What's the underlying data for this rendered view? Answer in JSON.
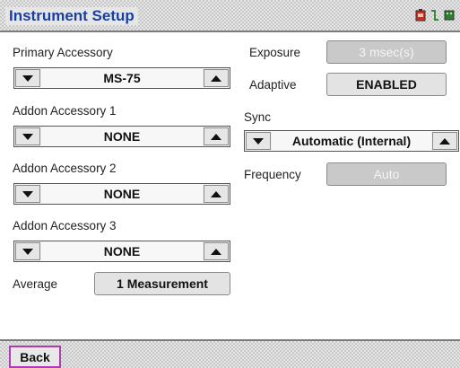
{
  "window": {
    "title": "Instrument Setup"
  },
  "status_icons": [
    "battery-icon",
    "connection-icon",
    "memory-card-icon"
  ],
  "left": {
    "primary_accessory": {
      "label": "Primary Accessory",
      "value": "MS-75"
    },
    "addon_1": {
      "label": "Addon Accessory 1",
      "value": "NONE"
    },
    "addon_2": {
      "label": "Addon Accessory 2",
      "value": "NONE"
    },
    "addon_3": {
      "label": "Addon Accessory 3",
      "value": "NONE"
    },
    "average": {
      "label": "Average",
      "value": "1 Measurement"
    }
  },
  "right": {
    "exposure": {
      "label": "Exposure",
      "value": "3 msec(s)",
      "enabled": false
    },
    "adaptive": {
      "label": "Adaptive",
      "value": "ENABLED",
      "enabled": true
    },
    "sync": {
      "label": "Sync",
      "value": "Automatic (Internal)"
    },
    "frequency": {
      "label": "Frequency",
      "value": "Auto",
      "enabled": false
    }
  },
  "footer": {
    "back_label": "Back"
  },
  "colors": {
    "title_text": "#1b3fa0",
    "back_border": "#b23ab5",
    "disabled_bg": "#c9c9c9"
  }
}
